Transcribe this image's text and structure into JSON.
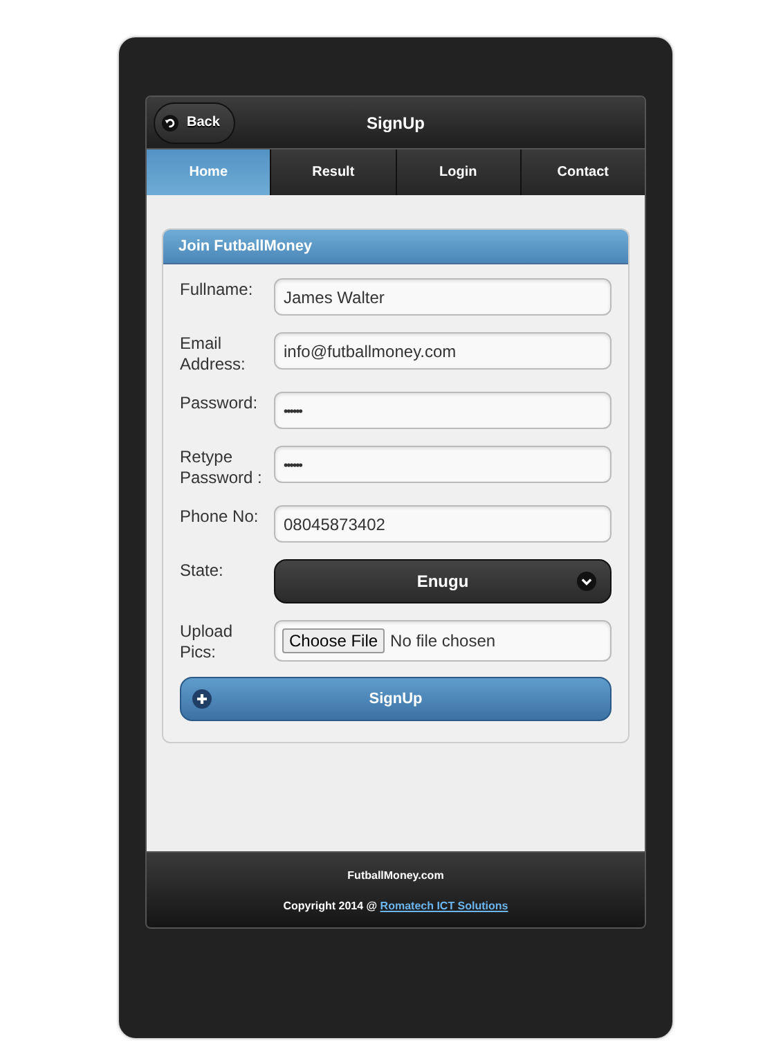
{
  "header": {
    "back_button": "Back",
    "title": "SignUp"
  },
  "tabs": [
    {
      "label": "Home",
      "selected": true
    },
    {
      "label": "Result",
      "selected": false
    },
    {
      "label": "Login",
      "selected": false
    },
    {
      "label": "Contact",
      "selected": false
    }
  ],
  "form": {
    "title": "Join FutballMoney",
    "fields": [
      {
        "kind": "text",
        "label": "Fullname:",
        "value": "James Walter"
      },
      {
        "kind": "text",
        "label": "Email Address:",
        "value": "info@futballmoney.com"
      },
      {
        "kind": "password",
        "label": "Password:",
        "value": "••••••"
      },
      {
        "kind": "password",
        "label": "Retype Password :",
        "value": "••••••"
      },
      {
        "kind": "text",
        "label": "Phone No:",
        "value": "08045873402"
      },
      {
        "kind": "select",
        "label": "State:",
        "value": "Enugu"
      },
      {
        "kind": "file",
        "label": "Upload Pics:",
        "button": "Choose File",
        "value": "No file chosen"
      }
    ],
    "submit": "SignUp"
  },
  "footer": {
    "site": "FutballMoney.com",
    "copyright": "Copyright 2014 @",
    "link": "Romatech ICT Solutions"
  }
}
